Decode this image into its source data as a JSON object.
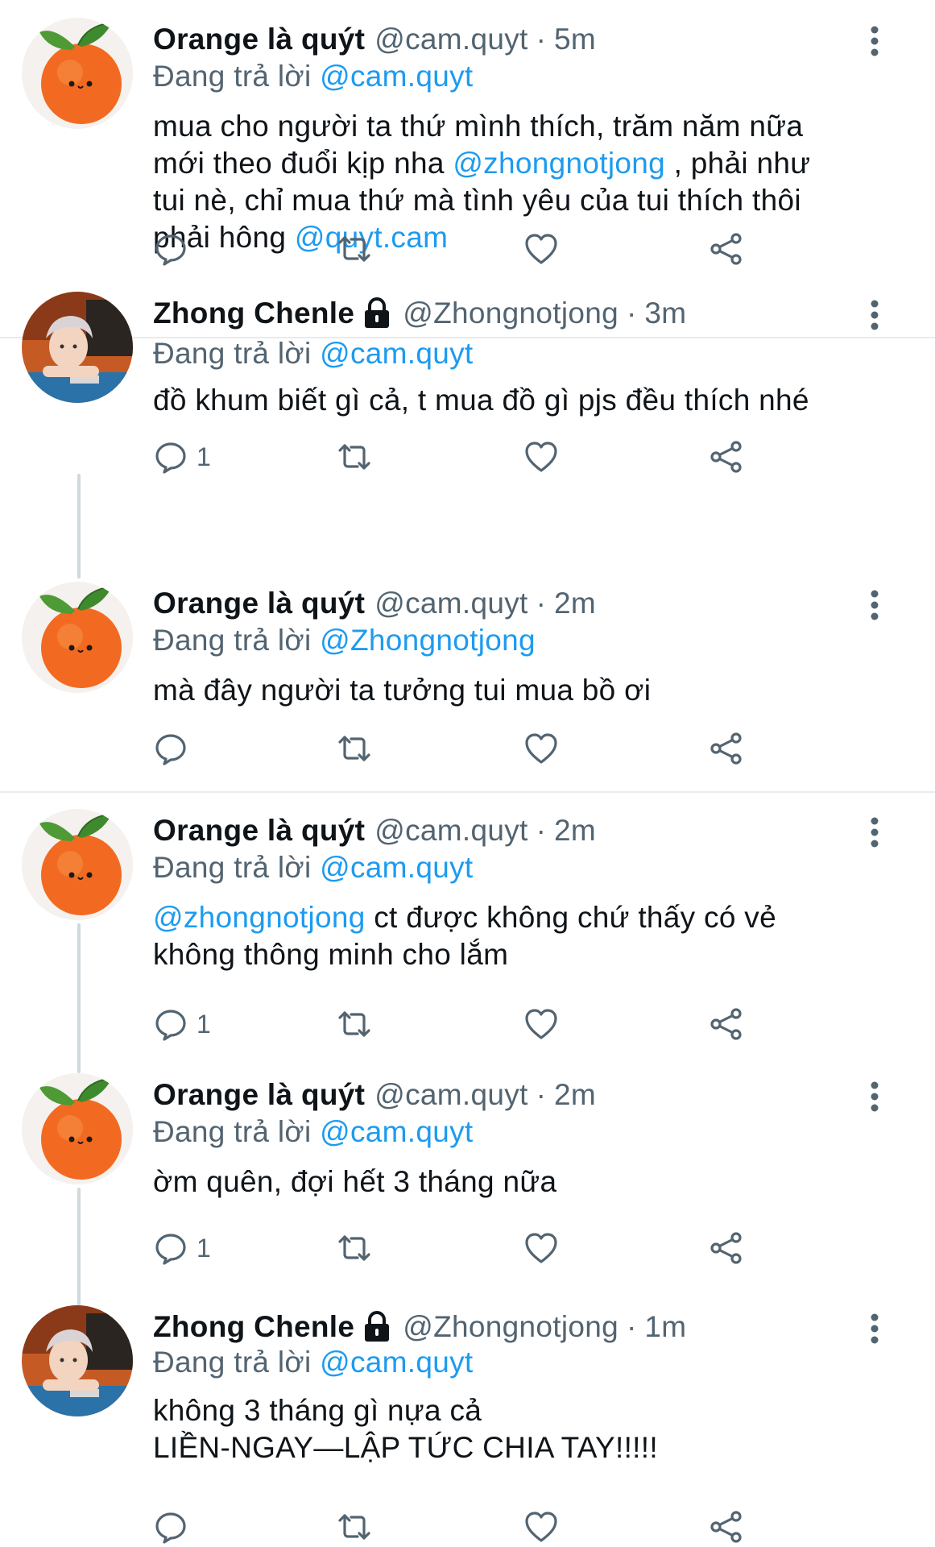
{
  "reply_prefix": "Đang trả lời",
  "separator": "·",
  "colors": {
    "link": "#1d9bf0",
    "secondary": "#536471",
    "divider": "#e6ecf0",
    "thread": "#cfd9de"
  },
  "tweets": [
    {
      "name": "Orange là quýt",
      "handle": "@cam.quyt",
      "time": "5m",
      "protected": false,
      "reply_to": "@cam.quyt",
      "body_lines": [
        [
          {
            "t": "mua cho người ta thứ mình thích, trăm năm nữa"
          }
        ],
        [
          {
            "t": "mới theo đuổi kịp nha "
          },
          {
            "t": "@zhongnotjong",
            "m": true
          },
          {
            "t": " , phải như"
          }
        ],
        [
          {
            "t": "tui nè, chỉ mua thứ mà tình yêu của tui thích thôi"
          }
        ],
        [
          {
            "t": "phải hông "
          },
          {
            "t": "@quyt.cam",
            "m": true
          }
        ]
      ],
      "reply_count": ""
    },
    {
      "name": "Zhong Chenle",
      "handle": "@Zhongnotjong",
      "time": "3m",
      "protected": true,
      "reply_to": "@cam.quyt",
      "body_lines": [
        [
          {
            "t": "đồ khum biết gì cả, t mua đồ gì pjs đều thích nhé"
          }
        ]
      ],
      "reply_count": "1"
    },
    {
      "name": "Orange là quýt",
      "handle": "@cam.quyt",
      "time": "2m",
      "protected": false,
      "reply_to": "@Zhongnotjong",
      "body_lines": [
        [
          {
            "t": "mà đây người ta tưởng tui mua bồ ơi"
          }
        ]
      ],
      "reply_count": ""
    },
    {
      "name": "Orange là quýt",
      "handle": "@cam.quyt",
      "time": "2m",
      "protected": false,
      "reply_to": "@cam.quyt",
      "body_lines": [
        [
          {
            "t": "@zhongnotjong",
            "m": true
          },
          {
            "t": " ct được không chứ thấy có vẻ"
          }
        ],
        [
          {
            "t": "không thông minh cho lắm"
          }
        ]
      ],
      "reply_count": "1"
    },
    {
      "name": "Orange là quýt",
      "handle": "@cam.quyt",
      "time": "2m",
      "protected": false,
      "reply_to": "@cam.quyt",
      "body_lines": [
        [
          {
            "t": "ờm quên, đợi hết 3 tháng nữa"
          }
        ]
      ],
      "reply_count": "1"
    },
    {
      "name": "Zhong Chenle",
      "handle": "@Zhongnotjong",
      "time": "1m",
      "protected": true,
      "reply_to": "@cam.quyt",
      "body_lines": [
        [
          {
            "t": "không 3 tháng gì nựa cả"
          }
        ],
        [
          {
            "t": "LIỀN-NGAY—LẬP TỨC CHIA TAY!!!!!"
          }
        ]
      ],
      "reply_count": ""
    }
  ]
}
